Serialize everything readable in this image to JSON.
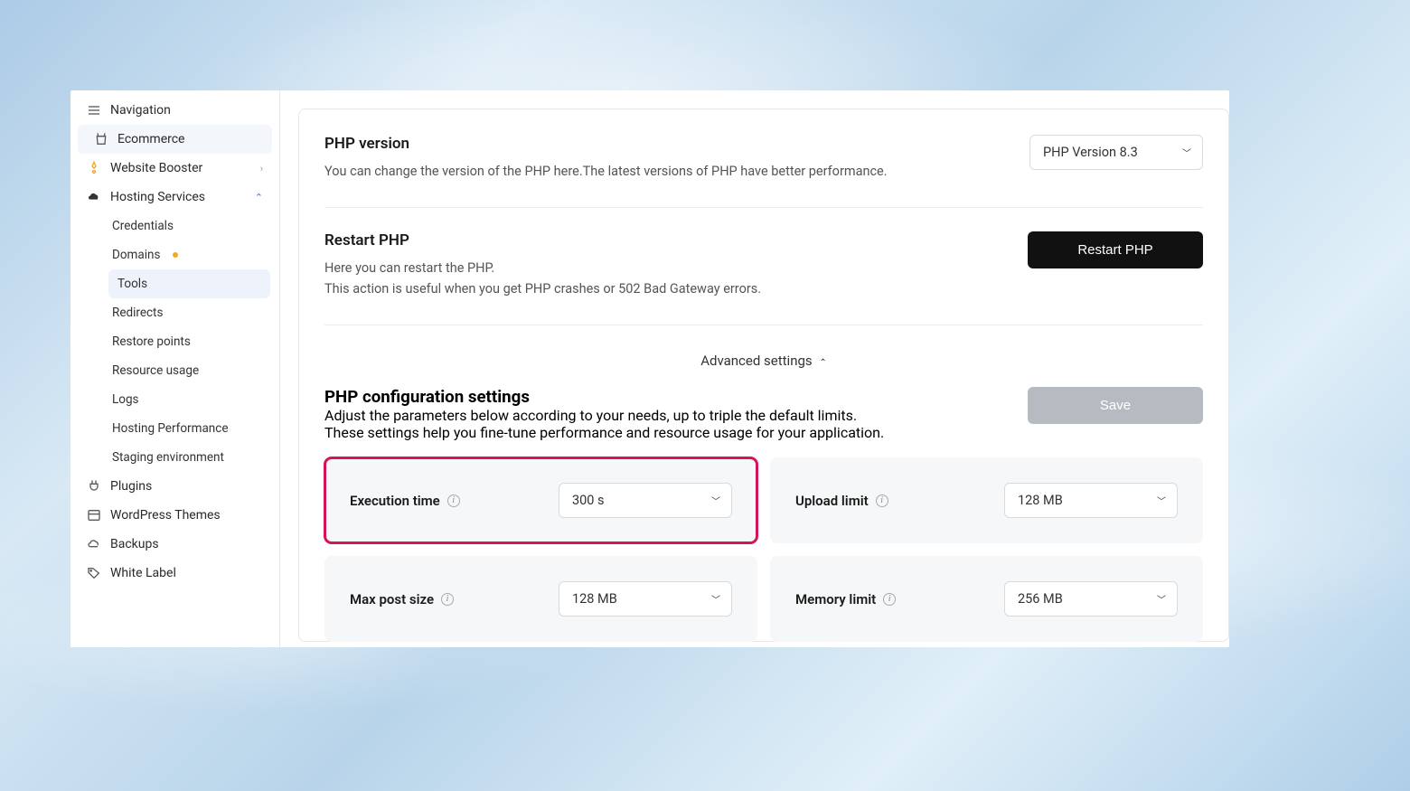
{
  "sidebar": {
    "navigation": "Navigation",
    "ecommerce": "Ecommerce",
    "website_booster": "Website Booster",
    "hosting_services": "Hosting Services",
    "plugins": "Plugins",
    "wordpress_themes": "WordPress Themes",
    "backups": "Backups",
    "white_label": "White Label",
    "sub": {
      "credentials": "Credentials",
      "domains": "Domains",
      "tools": "Tools",
      "redirects": "Redirects",
      "restore_points": "Restore points",
      "resource_usage": "Resource usage",
      "logs": "Logs",
      "hosting_performance": "Hosting Performance",
      "staging_environment": "Staging environment"
    }
  },
  "php_version": {
    "title": "PHP version",
    "desc": "You can change the version of the PHP here.The latest versions of PHP have better performance.",
    "selected": "PHP Version 8.3"
  },
  "restart": {
    "title": "Restart PHP",
    "line1": "Here you can restart the PHP.",
    "line2": "This action is useful when you get PHP crashes or 502 Bad Gateway errors.",
    "button": "Restart PHP"
  },
  "advanced_toggle": "Advanced settings",
  "config": {
    "title": "PHP configuration settings",
    "line1": "Adjust the parameters below according to your needs, up to triple the default limits.",
    "line2": "These settings help you fine-tune performance and resource usage for your application.",
    "save": "Save",
    "exec_label": "Execution time",
    "exec_value": "300 s",
    "upload_label": "Upload limit",
    "upload_value": "128 MB",
    "post_label": "Max post size",
    "post_value": "128 MB",
    "memory_label": "Memory limit",
    "memory_value": "256 MB"
  }
}
